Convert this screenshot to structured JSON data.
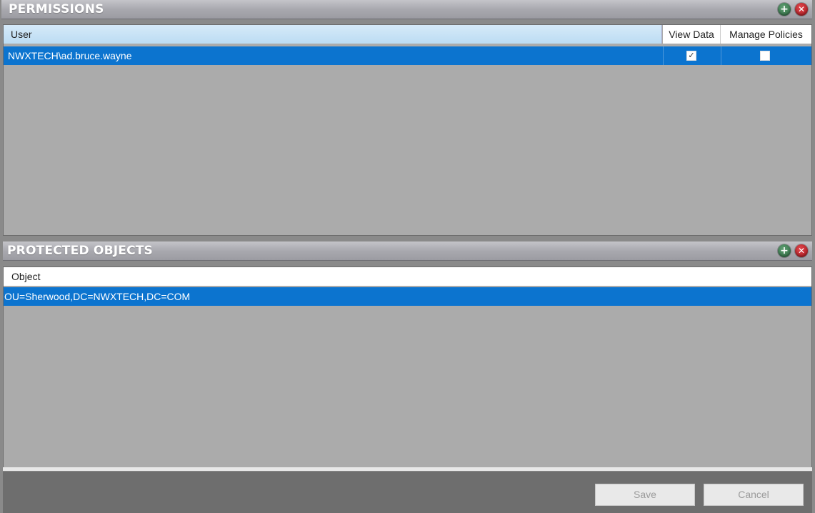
{
  "permissions": {
    "title": "PERMISSIONS",
    "columns": {
      "user": "User",
      "view_data": "View Data",
      "manage_policies": "Manage Policies"
    },
    "rows": [
      {
        "user": "NWXTECH\\ad.bruce.wayne",
        "view_data": true,
        "manage_policies": false
      }
    ]
  },
  "protected_objects": {
    "title": "PROTECTED OBJECTS",
    "columns": {
      "object": "Object"
    },
    "rows": [
      {
        "object": "OU=Sherwood,DC=NWXTECH,DC=COM"
      }
    ]
  },
  "footer": {
    "save_label": "Save",
    "cancel_label": "Cancel"
  },
  "icons": {
    "add": "plus-circle-icon",
    "remove": "x-circle-icon"
  },
  "colors": {
    "selection": "#0c74cf",
    "header_bg": "#a9a9af",
    "panel_bg": "#ababab"
  }
}
